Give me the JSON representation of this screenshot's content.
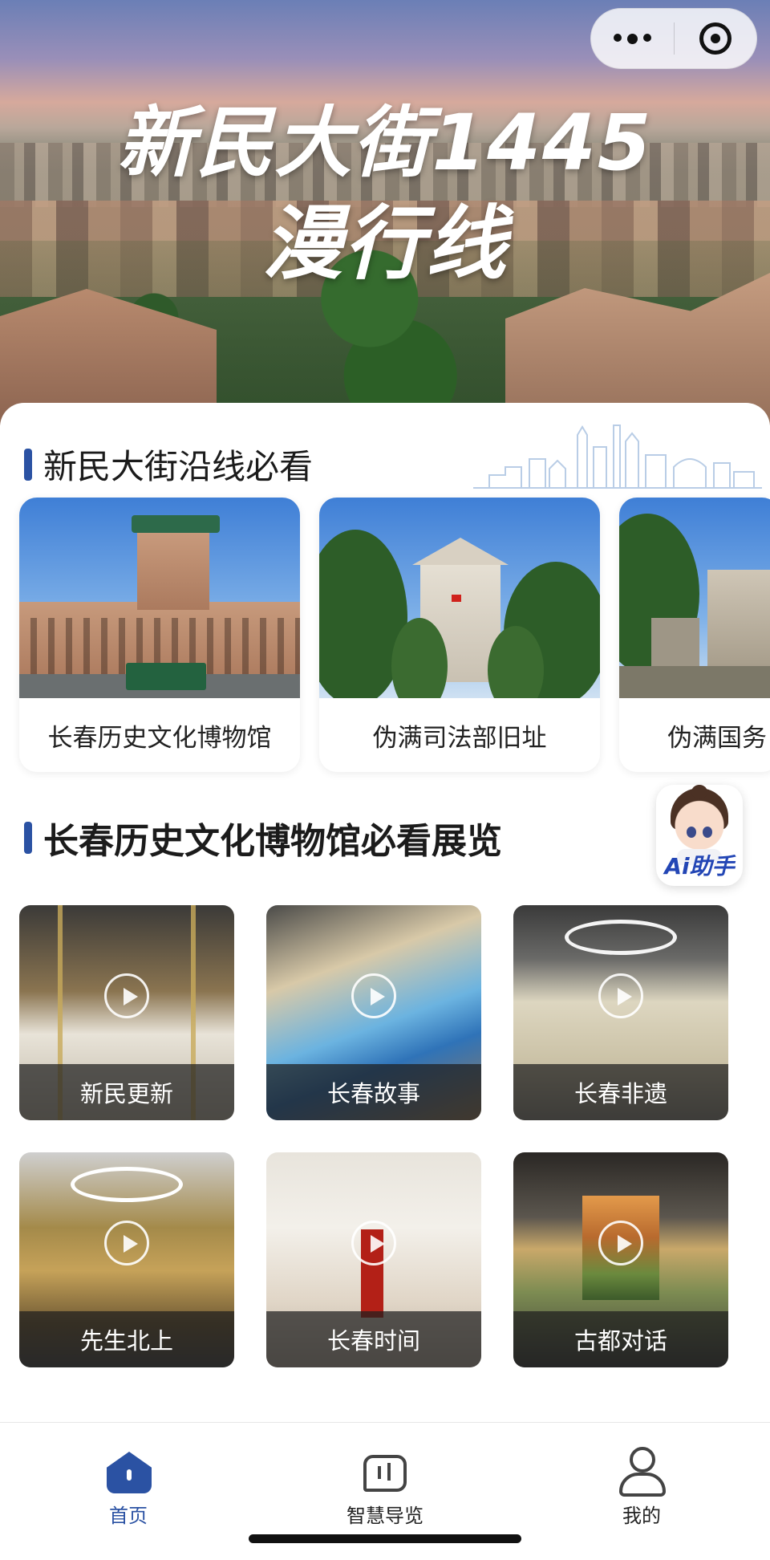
{
  "hero": {
    "title_line1": "新民大街1445",
    "title_line2": "漫行线"
  },
  "capsule": {
    "more_icon": "more-dots-icon",
    "close_icon": "target-icon"
  },
  "section1": {
    "title": "新民大街沿线必看",
    "attractions": [
      {
        "name": "长春历史文化博物馆",
        "photo": "museum-photo"
      },
      {
        "name": "伪满司法部旧址",
        "photo": "palace-photo"
      },
      {
        "name": "伪满国务",
        "photo": "gate-photo"
      }
    ]
  },
  "section2": {
    "title": "长春历史文化博物馆必看展览",
    "exhibits": [
      {
        "name": "新民更新"
      },
      {
        "name": "长春故事"
      },
      {
        "name": "长春非遗"
      },
      {
        "name": "先生北上"
      },
      {
        "name": "长春时间"
      },
      {
        "name": "古都对话"
      }
    ]
  },
  "ai_helper": {
    "label": "Ai助手"
  },
  "tabbar": {
    "tabs": [
      {
        "label": "首页",
        "icon": "home-icon",
        "active": true
      },
      {
        "label": "智慧导览",
        "icon": "guide-icon",
        "active": false
      },
      {
        "label": "我的",
        "icon": "profile-icon",
        "active": false
      }
    ]
  },
  "colors": {
    "accent": "#2b52a3",
    "active_tab": "#2b52a3"
  }
}
